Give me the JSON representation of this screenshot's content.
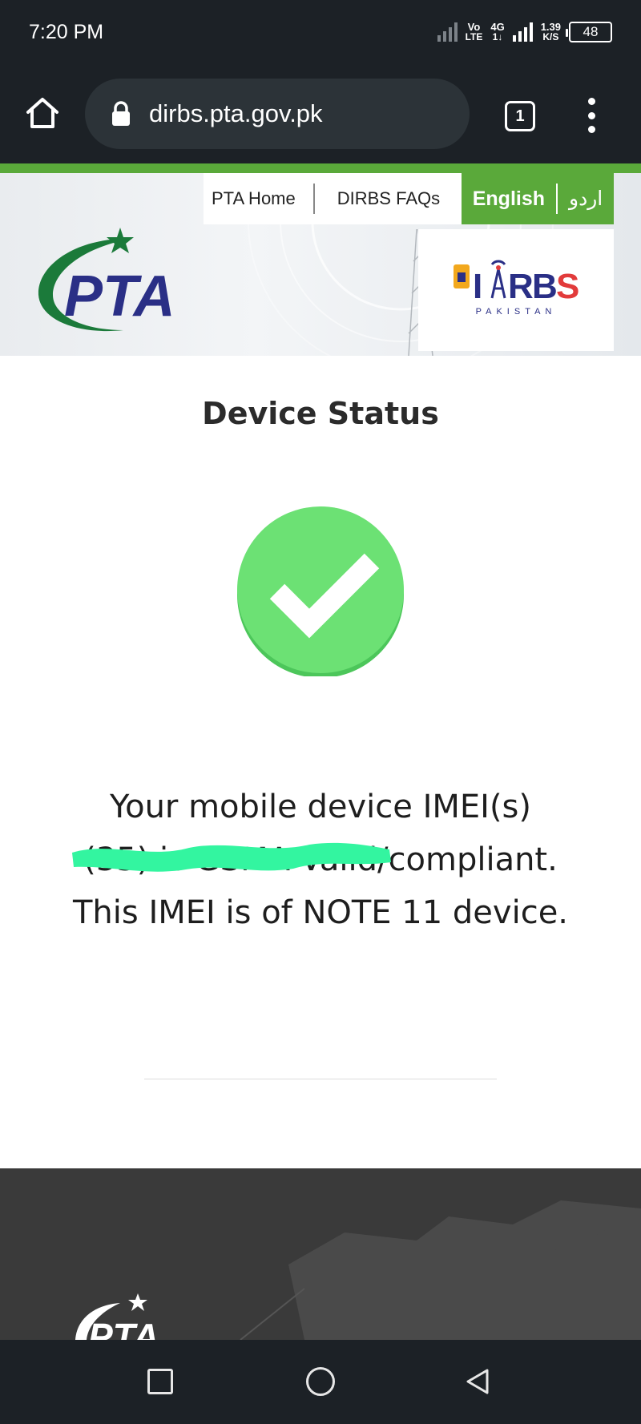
{
  "status_bar": {
    "time": "7:20 PM",
    "volte_top": "Vo",
    "volte_bottom": "LTE",
    "network_top": "4G",
    "network_bottom": "1↓",
    "speed_value": "1.39",
    "speed_unit": "K/S",
    "battery": "48"
  },
  "browser": {
    "url": "dirbs.pta.gov.pk",
    "tab_count": "1"
  },
  "site_nav": {
    "home": "PTA Home",
    "faqs": "DIRBS FAQs",
    "english": "English",
    "urdu": "اردو"
  },
  "logos": {
    "pta": "PTA",
    "dirbs": "DIRBS",
    "dirbs_sub": "PAKISTAN"
  },
  "main": {
    "title": "Device Status",
    "status_icon": "check-icon",
    "message_line1": "Your mobile device IMEI(s)",
    "message_imei": "(35",
    "message_mid": ") is GSMA Valid/compliant. This IMEI is of NOTE 11 device."
  },
  "footer": {
    "logo": "PTA"
  },
  "colors": {
    "brand_green": "#5aa93a",
    "check_green": "#6ce174",
    "pta_blue": "#2a2f86",
    "pta_green": "#1b7a3a",
    "scribble": "#33f5a0",
    "chrome_dark": "#1c2126"
  }
}
